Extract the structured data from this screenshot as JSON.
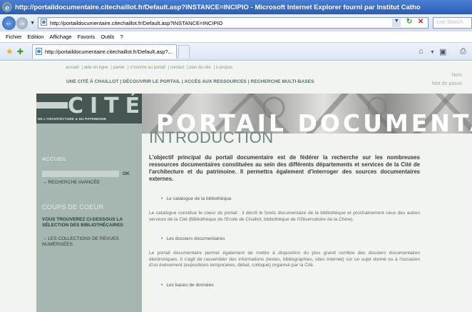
{
  "browser": {
    "title": "http://portaildocumentaire.citechaillot.fr/Default.asp?INSTANCE=INCIPIO - Microsoft Internet Explorer fourni par Institut Catho",
    "address": "http://portaildocumentaire.citechaillot.fr/Default.asp?INSTANCE=INCIPIO",
    "search_placeholder": "Live Search",
    "menu": [
      "Fichier",
      "Edition",
      "Affichage",
      "Favoris",
      "Outils",
      "?"
    ],
    "tab_title": "http://portaildocumentaire.citechaillot.fr/Default.asp?..."
  },
  "site": {
    "top_links": [
      "accueil",
      "aide en ligne",
      "panier",
      "s'inscrire au portail",
      "contact",
      "plan du site",
      "à propos"
    ],
    "main_nav": "UNE CITÉ À CHAILLOT | DÉCOUVRIR LE PORTAIL | ACCÈS AUX RESSOURCES | RECHERCHE MULTI-BASES",
    "login": {
      "name_label": "Nom",
      "password_label": "Mot de passe"
    },
    "logo": {
      "word": "CITÉ",
      "subtitle": "DE L'ARCHITECTURE & DU PATRIMOINE"
    },
    "banner_title": "PORTAIL DOCUMENTAIRE"
  },
  "sidebar": {
    "accueil": "ACCUEIL",
    "ok": "OK",
    "advanced_search": "→ RECHERCHE AVANCÉE",
    "coups_heading": "COUPS DE COEUR",
    "coups_text": "VOUS TROUVEREZ CI-DESSOUS LA SÉLECTION DES BIBLIOTHÉCAIRES",
    "collections_link": "→  LES COLLECTIONS DE REVUES NUMÉRISÉES"
  },
  "content": {
    "heading": "INTRODUCTION",
    "lead": "L'objectif principal du portail documentaire est de fédérer la recherche sur les nombreuses ressources documentaires constituées au sein des différents départements et services de la Cité de l'architecture et du patrimoine. Il permettra également d'interroger des sources documentaires externes.",
    "bullet1": "Le catalogue de la bibliothèque",
    "para1": "Le catalogue constitue le coeur du portail ; il décrit le fonds documentaire de la bibliothèque et prochainement ceux des autres services de la Cité (Bibliothèque de l'Ecole de Chaillot, bibliothèque de l'Observatoire de la Chine).",
    "bullet2": "Les dossiers documentaires",
    "para2": "Le portail documentaire permet également de mettre à disposition du plus grand nombre des dossiers documentaires électroniques. Il s'agit de rassembler des informations (textes, bibliographies, sites Internet) sur un sujet donné ou à l'occasion d'un événement (expositions temporaires, débat, colloque) organisé par la Cité.",
    "bullet3": "Les bases de données"
  }
}
